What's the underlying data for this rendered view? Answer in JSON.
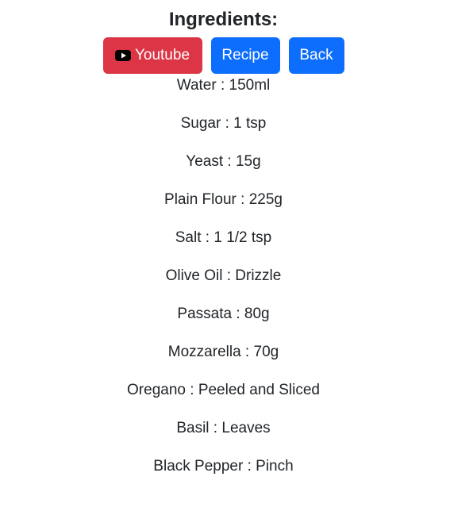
{
  "header": {
    "title": "Ingredients:"
  },
  "buttons": {
    "youtube_label": "Youtube",
    "recipe_label": "Recipe",
    "back_label": "Back",
    "youtube_icon": "youtube-icon"
  },
  "colors": {
    "danger": "#dc3545",
    "primary": "#0d6efd"
  },
  "ingredients": [
    {
      "name": "Water",
      "amount": "150ml"
    },
    {
      "name": "Sugar",
      "amount": "1 tsp"
    },
    {
      "name": "Yeast",
      "amount": "15g"
    },
    {
      "name": "Plain Flour",
      "amount": "225g"
    },
    {
      "name": "Salt",
      "amount": "1 1/2 tsp"
    },
    {
      "name": "Olive Oil",
      "amount": "Drizzle"
    },
    {
      "name": "Passata",
      "amount": "80g"
    },
    {
      "name": "Mozzarella",
      "amount": "70g"
    },
    {
      "name": "Oregano",
      "amount": "Peeled and Sliced"
    },
    {
      "name": "Basil",
      "amount": "Leaves"
    },
    {
      "name": "Black Pepper",
      "amount": "Pinch"
    }
  ]
}
